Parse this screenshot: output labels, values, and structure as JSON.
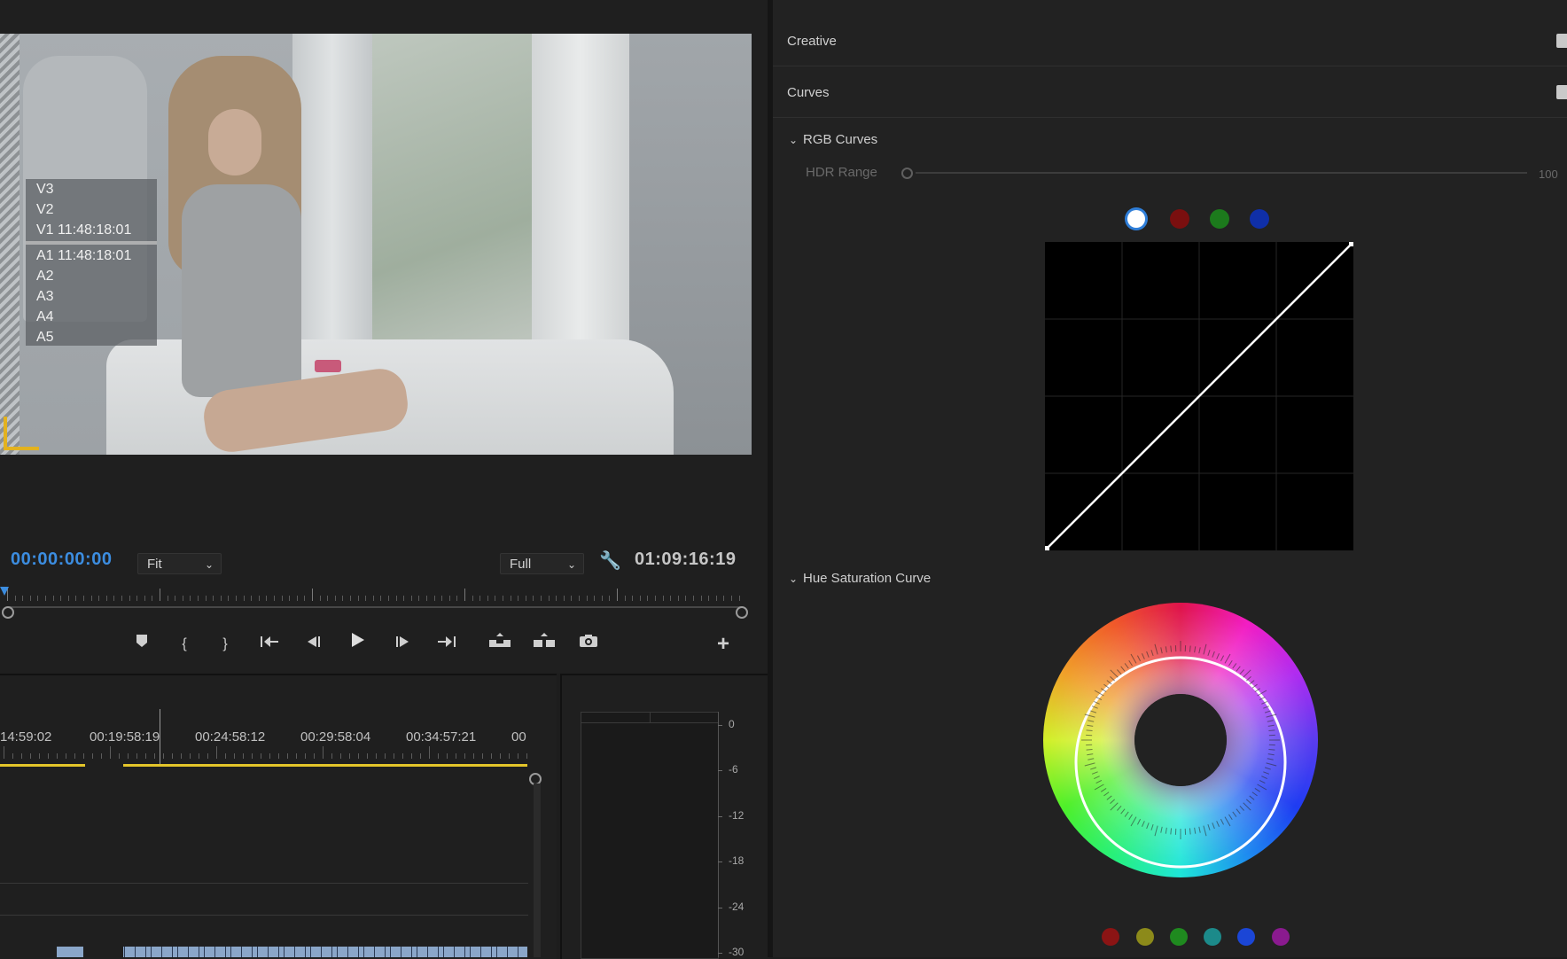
{
  "monitor": {
    "overlay_lines": [
      "V3",
      "V2",
      "V1 11:48:18:01",
      "A1 11:48:18:01",
      "A2",
      "A3",
      "A4",
      "A5"
    ],
    "timecode_current": "00:00:00:00",
    "timecode_duration": "01:09:16:19",
    "zoom_select": "Fit",
    "resolution_select": "Full",
    "accent_color": "#3c8de0"
  },
  "transport": {
    "buttons": [
      {
        "name": "add-marker-button",
        "icon": "marker-icon",
        "glyph": "⬟"
      },
      {
        "name": "mark-in-button",
        "icon": "mark-in-icon",
        "glyph": "{"
      },
      {
        "name": "mark-out-button",
        "icon": "mark-out-icon",
        "glyph": "}"
      },
      {
        "name": "go-to-in-button",
        "icon": "go-to-in-icon",
        "glyph": "⇤"
      },
      {
        "name": "step-back-button",
        "icon": "step-back-icon",
        "glyph": "◀|"
      },
      {
        "name": "play-button",
        "icon": "play-icon",
        "glyph": "▶"
      },
      {
        "name": "step-forward-button",
        "icon": "step-forward-icon",
        "glyph": "|▶"
      },
      {
        "name": "go-to-out-button",
        "icon": "go-to-out-icon",
        "glyph": "⇥"
      },
      {
        "name": "lift-button",
        "icon": "lift-icon",
        "glyph": "⏏"
      },
      {
        "name": "extract-button",
        "icon": "extract-icon",
        "glyph": "⏏"
      },
      {
        "name": "export-frame-button",
        "icon": "camera-icon",
        "glyph": "📷"
      },
      {
        "name": "button-editor-button",
        "icon": "plus-icon",
        "glyph": "+"
      }
    ]
  },
  "timeline": {
    "ruler_labels": [
      "14:59:02",
      "00:19:58:19",
      "00:24:58:12",
      "00:29:58:04",
      "00:34:57:21",
      "00"
    ]
  },
  "meter": {
    "db_labels": [
      "0",
      "-6",
      "-12",
      "-18",
      "-24",
      "-30"
    ]
  },
  "lumetri": {
    "sections": [
      "Creative",
      "Curves"
    ],
    "rgb_curves_label": "RGB Curves",
    "hdr_range_label": "HDR Range",
    "hdr_range_value": "100",
    "hue_sat_label": "Hue Saturation Curve",
    "channel_colors": [
      "#ffffff",
      "#7a0f0f",
      "#1c7a1c",
      "#0f2fa8"
    ],
    "swatch_colors": [
      "#8b1414",
      "#8c8a1a",
      "#1f8a1f",
      "#1c8a8a",
      "#1b46d6",
      "#8a1a8f"
    ]
  }
}
